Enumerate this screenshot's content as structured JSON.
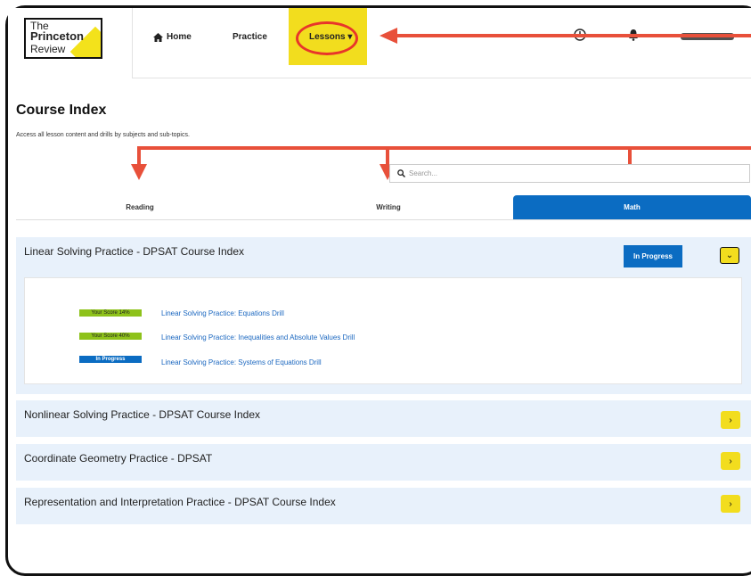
{
  "logo": {
    "line1": "The",
    "line2": "Princeton",
    "line3": "Review"
  },
  "nav": {
    "home": "Home",
    "practice": "Practice",
    "lessons": "Lessons ▾"
  },
  "page": {
    "title": "Course Index",
    "subtitle": "Access all lesson content and drills by subjects and sub-topics."
  },
  "search": {
    "placeholder": "Search..."
  },
  "tabs": [
    "Reading",
    "Writing",
    "Math"
  ],
  "active_tab": "Math",
  "sections": [
    {
      "title": "Linear Solving Practice - DPSAT Course Index",
      "status": "In Progress",
      "expanded": true
    },
    {
      "title": "Nonlinear Solving Practice - DPSAT Course Index"
    },
    {
      "title": "Coordinate Geometry Practice - DPSAT"
    },
    {
      "title": "Representation and Interpretation Practice - DPSAT Course Index"
    }
  ],
  "drills": [
    {
      "badge": "Your Score 14%",
      "title": "Linear Solving Practice: Equations Drill"
    },
    {
      "badge": "Your Score 40%",
      "title": "Linear Solving Practice: Inequalities and Absolute Values Drill"
    },
    {
      "badge": "In Progress",
      "title": "Linear Solving Practice: Systems of Equations Drill"
    }
  ],
  "colors": {
    "accent_yellow": "#f2dd1e",
    "primary_blue": "#0b6cc2",
    "score_green": "#8ec21b",
    "annotation_red": "#e8503a"
  }
}
